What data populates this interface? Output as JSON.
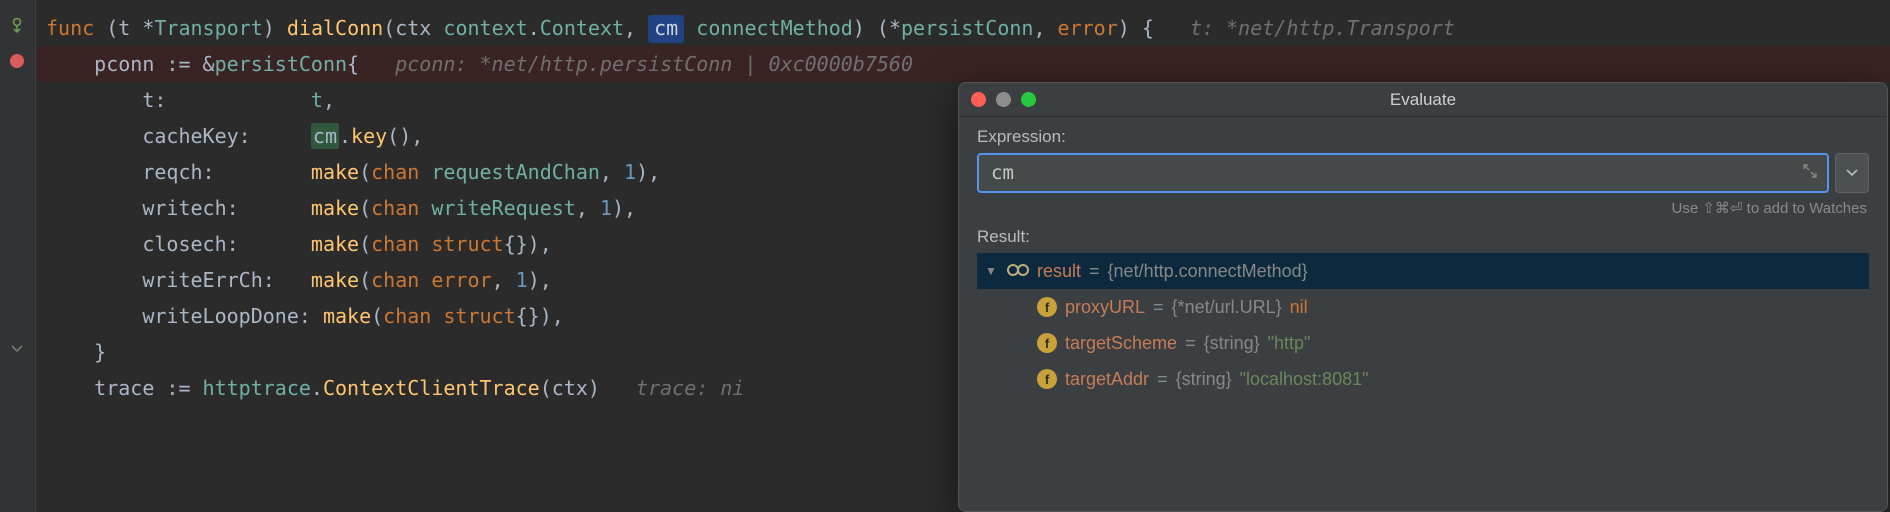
{
  "editor": {
    "lines": [
      {
        "bp": false,
        "indent": "",
        "tokens": [
          {
            "t": "func ",
            "c": "kw"
          },
          {
            "t": "(t *",
            "c": "par"
          },
          {
            "t": "Transport",
            "c": "typ"
          },
          {
            "t": ") ",
            "c": "par"
          },
          {
            "t": "dialConn",
            "c": "fn"
          },
          {
            "t": "(ctx ",
            "c": "par"
          },
          {
            "t": "context",
            "c": "typ"
          },
          {
            "t": ".",
            "c": "par"
          },
          {
            "t": "Context",
            "c": "typ"
          },
          {
            "t": ", ",
            "c": "par"
          },
          {
            "t": "cm",
            "c": "hl-box"
          },
          {
            "t": " ",
            "c": "par"
          },
          {
            "t": "connectMethod",
            "c": "typ"
          },
          {
            "t": ") (*",
            "c": "par"
          },
          {
            "t": "persistConn",
            "c": "typ"
          },
          {
            "t": ", ",
            "c": "par"
          },
          {
            "t": "error",
            "c": "kw"
          },
          {
            "t": ") {   ",
            "c": "par"
          },
          {
            "t": "t: *net/http.Transport",
            "c": "inlay"
          }
        ]
      },
      {
        "bp": true,
        "indent": "    ",
        "tokens": [
          {
            "t": "pconn := &",
            "c": "par"
          },
          {
            "t": "persistConn",
            "c": "typ"
          },
          {
            "t": "{   ",
            "c": "par"
          },
          {
            "t": "pconn: *net/http.persistConn | 0xc0000b7560",
            "c": "inlay"
          }
        ]
      },
      {
        "bp": false,
        "indent": "        ",
        "tokens": [
          {
            "t": "t:            ",
            "c": "par"
          },
          {
            "t": "t",
            "c": "typ"
          },
          {
            "t": ",",
            "c": "par"
          }
        ]
      },
      {
        "bp": false,
        "indent": "        ",
        "tokens": [
          {
            "t": "cacheKey:     ",
            "c": "par"
          },
          {
            "t": "cm",
            "c": "var-use"
          },
          {
            "t": ".",
            "c": "par"
          },
          {
            "t": "key",
            "c": "fn"
          },
          {
            "t": "(),",
            "c": "par"
          }
        ]
      },
      {
        "bp": false,
        "indent": "        ",
        "tokens": [
          {
            "t": "reqch:        ",
            "c": "par"
          },
          {
            "t": "make",
            "c": "fn"
          },
          {
            "t": "(",
            "c": "par"
          },
          {
            "t": "chan ",
            "c": "kw"
          },
          {
            "t": "requestAndChan",
            "c": "typ"
          },
          {
            "t": ", ",
            "c": "par"
          },
          {
            "t": "1",
            "c": "num"
          },
          {
            "t": "),",
            "c": "par"
          }
        ]
      },
      {
        "bp": false,
        "indent": "        ",
        "tokens": [
          {
            "t": "writech:      ",
            "c": "par"
          },
          {
            "t": "make",
            "c": "fn"
          },
          {
            "t": "(",
            "c": "par"
          },
          {
            "t": "chan ",
            "c": "kw"
          },
          {
            "t": "writeRequest",
            "c": "typ"
          },
          {
            "t": ", ",
            "c": "par"
          },
          {
            "t": "1",
            "c": "num"
          },
          {
            "t": "),",
            "c": "par"
          }
        ]
      },
      {
        "bp": false,
        "indent": "        ",
        "tokens": [
          {
            "t": "closech:      ",
            "c": "par"
          },
          {
            "t": "make",
            "c": "fn"
          },
          {
            "t": "(",
            "c": "par"
          },
          {
            "t": "chan struct",
            "c": "kw"
          },
          {
            "t": "{}),",
            "c": "par"
          }
        ]
      },
      {
        "bp": false,
        "indent": "        ",
        "tokens": [
          {
            "t": "writeErrCh:   ",
            "c": "par"
          },
          {
            "t": "make",
            "c": "fn"
          },
          {
            "t": "(",
            "c": "par"
          },
          {
            "t": "chan ",
            "c": "kw"
          },
          {
            "t": "error",
            "c": "kw"
          },
          {
            "t": ", ",
            "c": "par"
          },
          {
            "t": "1",
            "c": "num"
          },
          {
            "t": "),",
            "c": "par"
          }
        ]
      },
      {
        "bp": false,
        "indent": "        ",
        "tokens": [
          {
            "t": "writeLoopDone: ",
            "c": "par"
          },
          {
            "t": "make",
            "c": "fn"
          },
          {
            "t": "(",
            "c": "par"
          },
          {
            "t": "chan struct",
            "c": "kw"
          },
          {
            "t": "{}),",
            "c": "par"
          }
        ]
      },
      {
        "bp": false,
        "indent": "    ",
        "tokens": [
          {
            "t": "}",
            "c": "par"
          }
        ]
      },
      {
        "bp": false,
        "indent": "    ",
        "tokens": [
          {
            "t": "trace := ",
            "c": "par"
          },
          {
            "t": "httptrace",
            "c": "typ"
          },
          {
            "t": ".",
            "c": "par"
          },
          {
            "t": "ContextClientTrace",
            "c": "fn"
          },
          {
            "t": "(ctx)   ",
            "c": "par"
          },
          {
            "t": "trace: ni",
            "c": "inlay"
          }
        ]
      }
    ],
    "gutterIcons": [
      {
        "line": 0,
        "kind": "impl"
      },
      {
        "line": 1,
        "kind": "breakpoint"
      },
      {
        "line": 9,
        "kind": "fold"
      }
    ]
  },
  "popup": {
    "title": "Evaluate",
    "expressionLabel": "Expression:",
    "expressionValue": "cm",
    "hint": "Use ⇧⌘⏎ to add to Watches",
    "resultLabel": "Result:",
    "tree": {
      "root": {
        "name": "result",
        "value": "{net/http.connectMethod}",
        "expanded": true
      },
      "children": [
        {
          "name": "proxyURL",
          "type": "{*net/url.URL}",
          "value": "nil",
          "valClass": "r-nil"
        },
        {
          "name": "targetScheme",
          "type": "{string}",
          "value": "\"http\"",
          "valClass": "r-val"
        },
        {
          "name": "targetAddr",
          "type": "{string}",
          "value": "\"localhost:8081\"",
          "valClass": "r-val"
        }
      ]
    }
  }
}
